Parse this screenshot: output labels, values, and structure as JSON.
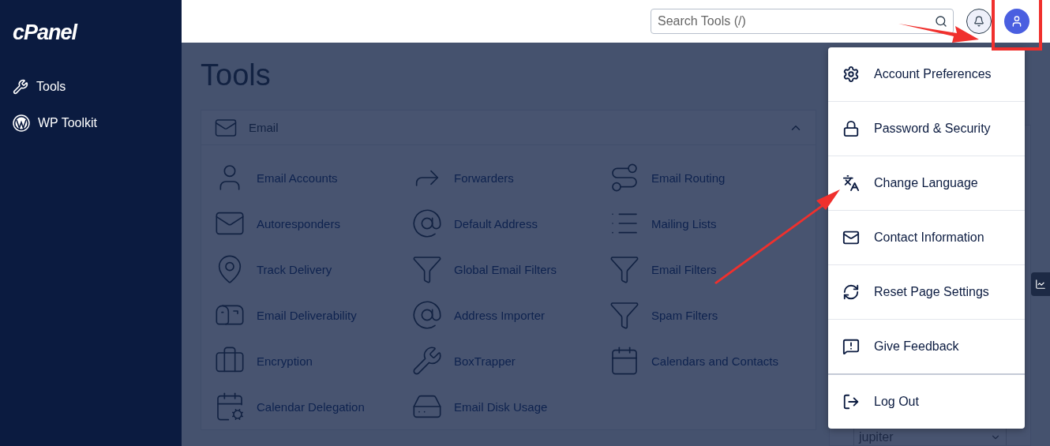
{
  "sidebar": {
    "logo": "cPanel",
    "items": [
      {
        "label": "Tools",
        "selected": false
      },
      {
        "label": "WP Toolkit",
        "selected": false
      }
    ]
  },
  "header": {
    "search": {
      "placeholder": "Search Tools (/)"
    }
  },
  "page": {
    "title": "Tools"
  },
  "email_section": {
    "title": "Email",
    "expanded": true,
    "tools": [
      {
        "label": "Email Accounts"
      },
      {
        "label": "Forwarders"
      },
      {
        "label": "Email Routing"
      },
      {
        "label": "Autoresponders"
      },
      {
        "label": "Default Address"
      },
      {
        "label": "Mailing Lists"
      },
      {
        "label": "Track Delivery"
      },
      {
        "label": "Global Email Filters"
      },
      {
        "label": "Email Filters"
      },
      {
        "label": "Email Deliverability"
      },
      {
        "label": "Address Importer"
      },
      {
        "label": "Spam Filters"
      },
      {
        "label": "Encryption"
      },
      {
        "label": "BoxTrapper"
      },
      {
        "label": "Calendars and Contacts"
      },
      {
        "label": "Calendar Delegation"
      },
      {
        "label": "Email Disk Usage"
      }
    ]
  },
  "side_panel": {
    "theme_select": {
      "value": "jupiter"
    }
  },
  "user_menu": {
    "open": true,
    "items": [
      {
        "label": "Account Preferences"
      },
      {
        "label": "Password & Security"
      },
      {
        "label": "Change Language"
      },
      {
        "label": "Contact Information"
      },
      {
        "label": "Reset Page Settings"
      },
      {
        "label": "Give Feedback"
      },
      {
        "label": "Log Out"
      }
    ]
  }
}
